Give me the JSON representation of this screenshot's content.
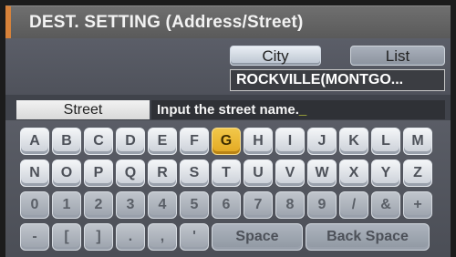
{
  "header": {
    "title": "DEST. SETTING (Address/Street)"
  },
  "tabs": {
    "city": "City",
    "list": "List"
  },
  "city_value": "ROCKVILLE(MONTGO...",
  "street": {
    "label": "Street",
    "placeholder": "Input the street name.",
    "cursor": "_"
  },
  "keyboard": {
    "row1": [
      "A",
      "B",
      "C",
      "D",
      "E",
      "F",
      "G",
      "H",
      "I",
      "J",
      "K",
      "L",
      "M"
    ],
    "row2": [
      "N",
      "O",
      "P",
      "Q",
      "R",
      "S",
      "T",
      "U",
      "V",
      "W",
      "X",
      "Y",
      "Z"
    ],
    "row3": [
      "0",
      "1",
      "2",
      "3",
      "4",
      "5",
      "6",
      "7",
      "8",
      "9",
      "/",
      "&",
      "+"
    ],
    "row4": [
      "-",
      "[",
      "]",
      ".",
      ",",
      "'"
    ],
    "space": "Space",
    "backspace": "Back Space",
    "selected": "G"
  },
  "colors": {
    "accent": "#d7823a",
    "highlight": "#f2c84a"
  }
}
